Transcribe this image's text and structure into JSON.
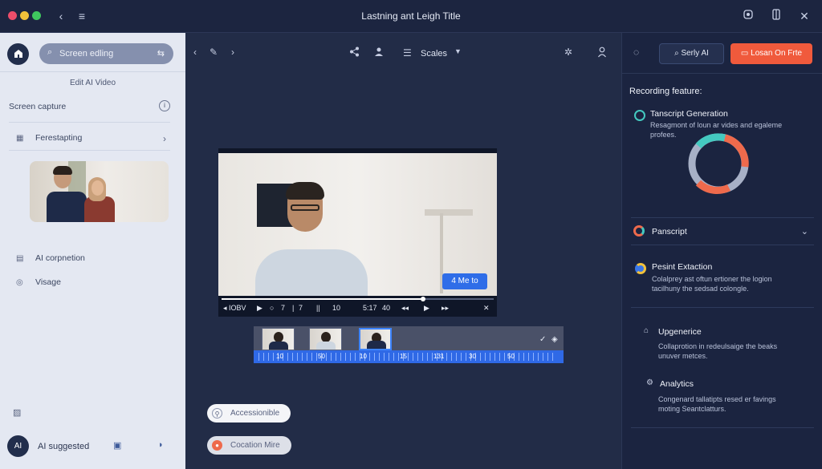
{
  "window": {
    "title": "Lastning ant Leigh Title"
  },
  "sidebar": {
    "search_placeholder": "Screen edling",
    "subtitle": "Edit AI Video",
    "screen_capture": "Screen capture",
    "folder_item": "Ferestapting",
    "nav": [
      {
        "label": "AI corpnetion",
        "icon": "ai-chip-icon"
      },
      {
        "label": "Visage",
        "icon": "visage-icon"
      }
    ],
    "user_label": "AI suggested",
    "avatar_initials": "AI"
  },
  "toolbar": {
    "scales_label": "Scales"
  },
  "player": {
    "button_label": "4 Me to",
    "progress": 0.74,
    "controls": [
      {
        "label": "◂ IOBV",
        "icon": "rewind-icon"
      },
      {
        "label": "▶",
        "icon": "play-icon"
      },
      {
        "label": "○",
        "icon": "loop-icon"
      },
      {
        "label": "7",
        "icon": "counter-icon"
      },
      {
        "label": "|",
        "icon": "divider-icon"
      },
      {
        "label": "7",
        "icon": "counter-icon"
      },
      {
        "label": "||",
        "icon": "split-icon"
      },
      {
        "label": "10",
        "icon": "counter-icon"
      },
      {
        "label": "5:17",
        "icon": "time-icon"
      },
      {
        "label": "40",
        "icon": "counter-icon"
      },
      {
        "label": "◂◂",
        "icon": "back-icon"
      },
      {
        "label": "▶",
        "icon": "play-icon"
      },
      {
        "label": "▸▸",
        "icon": "forward-icon"
      },
      {
        "label": "✕",
        "icon": "close-icon"
      }
    ]
  },
  "timeline": {
    "ruler": [
      "10",
      "50",
      "10",
      "15",
      "131",
      "30",
      "50"
    ]
  },
  "pills": {
    "accessibility": "Accessionible",
    "location": "Cocation Mire"
  },
  "right_panel": {
    "btn_ai": "Serly AI",
    "btn_login": "Losan On Frte",
    "heading": "Recording feature:",
    "features": [
      {
        "title": "Tanscript Generation",
        "desc": "Resagmont of loun ar vides and egaleme profees."
      },
      {
        "title": "Panscript",
        "desc": ""
      },
      {
        "title": "Pesint Extaction",
        "desc": "Colalprey ast oftun ertioner the logion tacilhuny the sedsad colongle."
      },
      {
        "title": "Upgenerice",
        "desc": "Collaprotion in redeulsaige the beaks unuver metces."
      },
      {
        "title": "Analytics",
        "desc": "Congenard tallatipts resed er favings moting Seantclatturs."
      }
    ]
  },
  "colors": {
    "accent_orange": "#f05a3c",
    "accent_blue": "#2f6de8",
    "dark_bg": "#1d2740",
    "ring_teal": "#44c9c0",
    "ring_orange": "#ee6a4c",
    "ring_grey": "#a7b0c6"
  }
}
